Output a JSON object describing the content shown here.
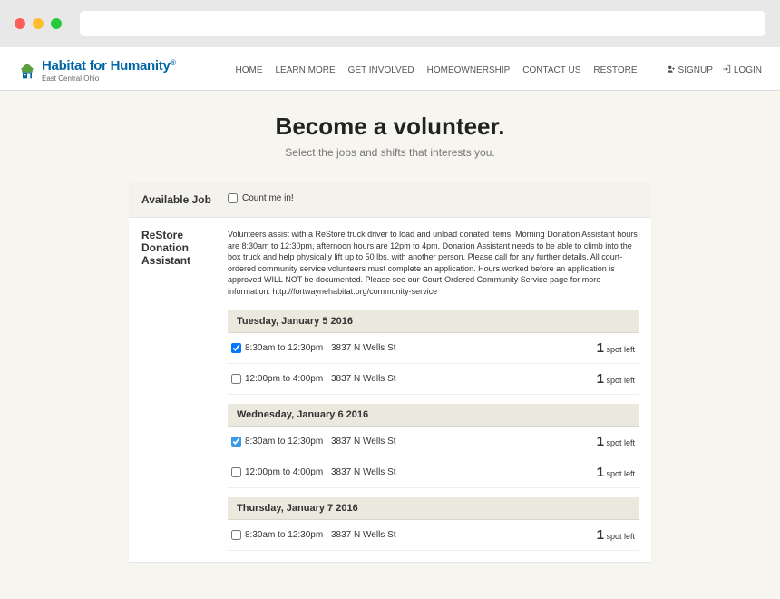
{
  "logo": {
    "main": "Habitat for Humanity",
    "sub": "East Central Ohio",
    "reg": "®"
  },
  "nav": {
    "items": [
      "HOME",
      "LEARN MORE",
      "GET INVOLVED",
      "HOMEOWNERSHIP",
      "CONTACT US",
      "RESTORE"
    ],
    "signup": "SIGNUP",
    "login": "LOGIN"
  },
  "hero": {
    "title": "Become a volunteer.",
    "sub": "Select the jobs and shifts that interests you."
  },
  "available": {
    "title": "Available Job",
    "count_label": "Count me in!"
  },
  "job": {
    "title": "ReStore Donation Assistant",
    "desc": "Volunteers assist with a ReStore truck driver to load and unload donated items. Morning Donation Assistant hours are 8:30am to 12:30pm, afternoon hours are 12pm to 4pm. Donation Assistant needs to be able to climb into the box truck and help physically lift up to 50 lbs. with another person. Please call for any further details. All court-ordered community service volunteers must complete an application. Hours worked before an application is approved WILL NOT be documented. Please see our Court-Ordered Community Service page for more information. http://fortwaynehabitat.org/community-service",
    "dates": [
      {
        "label": "Tuesday, January 5 2016",
        "shifts": [
          {
            "time": "8:30am to 12:30pm",
            "loc": "3837 N Wells St",
            "spots_num": "1",
            "spots_label": "spot left",
            "checked": true,
            "hl": false
          },
          {
            "time": "12:00pm to 4:00pm",
            "loc": "3837 N Wells St",
            "spots_num": "1",
            "spots_label": "spot left",
            "checked": false,
            "hl": false
          }
        ]
      },
      {
        "label": "Wednesday, January 6 2016",
        "shifts": [
          {
            "time": "8:30am to 12:30pm",
            "loc": "3837 N Wells St",
            "spots_num": "1",
            "spots_label": "spot left",
            "checked": true,
            "hl": true
          },
          {
            "time": "12:00pm to 4:00pm",
            "loc": "3837 N Wells St",
            "spots_num": "1",
            "spots_label": "spot left",
            "checked": false,
            "hl": false
          }
        ]
      },
      {
        "label": "Thursday, January 7 2016",
        "shifts": [
          {
            "time": "8:30am to 12:30pm",
            "loc": "3837 N Wells St",
            "spots_num": "1",
            "spots_label": "spot left",
            "checked": false,
            "hl": false
          }
        ]
      }
    ]
  }
}
